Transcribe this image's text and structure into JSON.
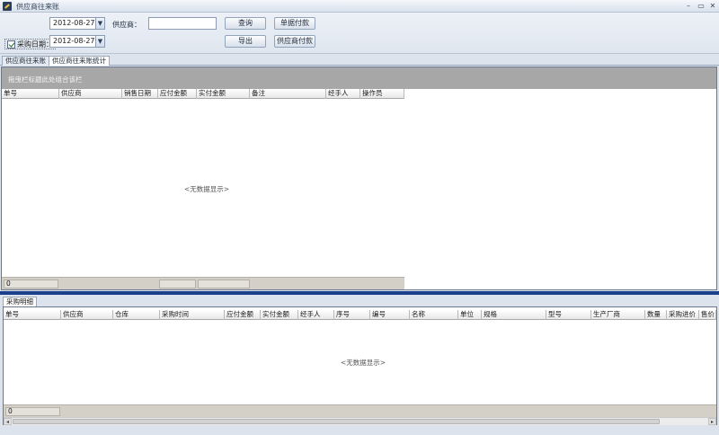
{
  "window": {
    "title": "供应商往来账",
    "minimize_glyph": "–",
    "restore_glyph": "▭",
    "close_glyph": "✕"
  },
  "toolbar": {
    "purchase_date_label": "采购日期：",
    "date_from": "2012-08-27",
    "date_to": "2012-08-27",
    "supplier_label": "供应商：",
    "supplier_value": "",
    "query_button": "查询",
    "export_button": "导出",
    "bill_payment_button": "单据付款",
    "supplier_payment_button": "供应商付款"
  },
  "tabs": [
    {
      "label": "供应商往来账",
      "active": false
    },
    {
      "label": "供应商往来账统计",
      "active": true
    }
  ],
  "upper_grid": {
    "group_hint": "拖曳栏标题此处组合该栏",
    "columns": [
      "单号",
      "供应商",
      "销售日期",
      "应付金额",
      "实付金额",
      "备注",
      "经手人",
      "操作员"
    ],
    "no_data_text": "<无数据显示>",
    "footer_count": "0"
  },
  "lower_panel": {
    "tab_label": "采购明细",
    "columns": [
      "单号",
      "供应商",
      "仓库",
      "采购时间",
      "应付金额",
      "实付金额",
      "经手人",
      "序号",
      "编号",
      "名称",
      "单位",
      "规格",
      "型号",
      "生产厂商",
      "数量",
      "采购进价",
      "售价"
    ],
    "no_data_text": "<无数据显示>",
    "footer_count": "0",
    "scroll_left_glyph": "◂",
    "scroll_right_glyph": "▸"
  }
}
